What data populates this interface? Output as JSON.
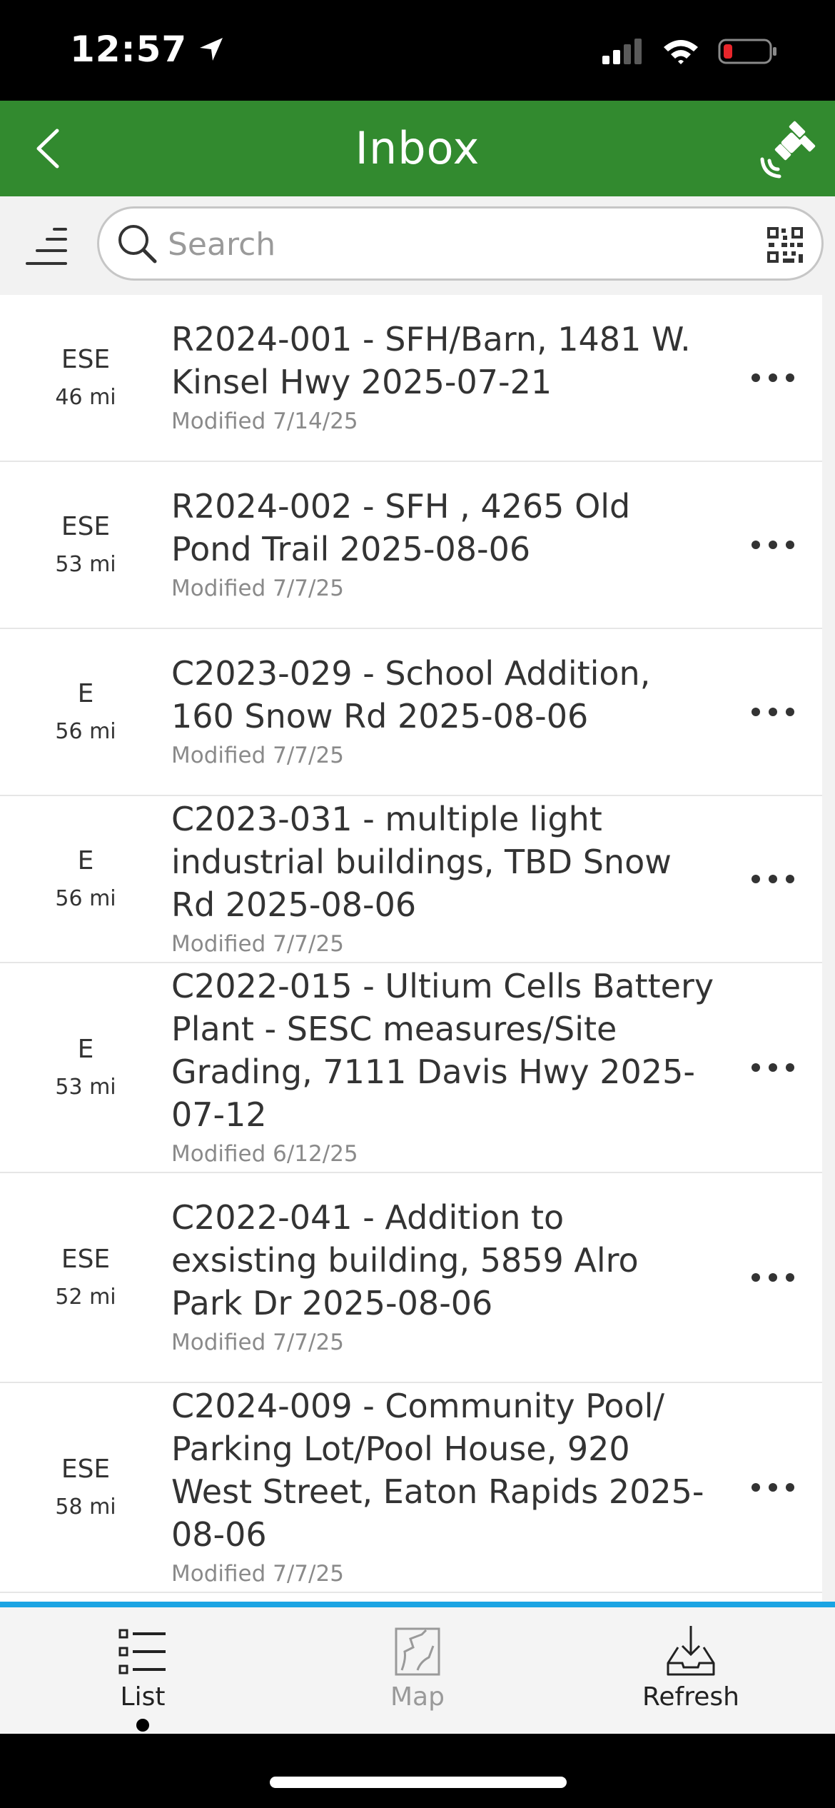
{
  "status_bar": {
    "time": "12:57"
  },
  "header": {
    "title": "Inbox"
  },
  "search": {
    "placeholder": "Search"
  },
  "items": [
    {
      "direction": "ESE",
      "distance": "46 mi",
      "title": "R2024-001 - SFH/Barn, 1481 W. Kinsel Hwy 2025-07-21",
      "modified": "Modified 7/14/25"
    },
    {
      "direction": "ESE",
      "distance": "53 mi",
      "title": "R2024-002 - SFH , 4265 Old Pond Trail 2025-08-06",
      "modified": "Modified 7/7/25"
    },
    {
      "direction": "E",
      "distance": "56 mi",
      "title": "C2023-029 - School Addition, 160 Snow Rd 2025-08-06",
      "modified": "Modified 7/7/25"
    },
    {
      "direction": "E",
      "distance": "56 mi",
      "title": "C2023-031 - multiple light industrial buildings, TBD Snow Rd 2025-08-06",
      "modified": "Modified 7/7/25"
    },
    {
      "direction": "E",
      "distance": "53 mi",
      "title": "C2022-015 - Ultium Cells Battery Plant - SESC measures/Site Grading, 7111 Davis Hwy 2025-07-12",
      "modified": "Modified 6/12/25"
    },
    {
      "direction": "ESE",
      "distance": "52 mi",
      "title": "C2022-041 - Addition to exsisting building, 5859 Alro Park Dr 2025-08-06",
      "modified": "Modified 7/7/25"
    },
    {
      "direction": "ESE",
      "distance": "58 mi",
      "title": "C2024-009 - Community Pool/ Parking Lot/Pool House, 920 West Street, Eaton Rapids 2025-08-06",
      "modified": "Modified 7/7/25"
    }
  ],
  "tabs": {
    "list": {
      "label": "List",
      "selected": true
    },
    "map": {
      "label": "Map",
      "enabled": false
    },
    "refresh": {
      "label": "Refresh"
    }
  },
  "colors": {
    "header": "#328a2f",
    "accent_line": "#1ba4e3",
    "battery_low": "#e8262b"
  }
}
